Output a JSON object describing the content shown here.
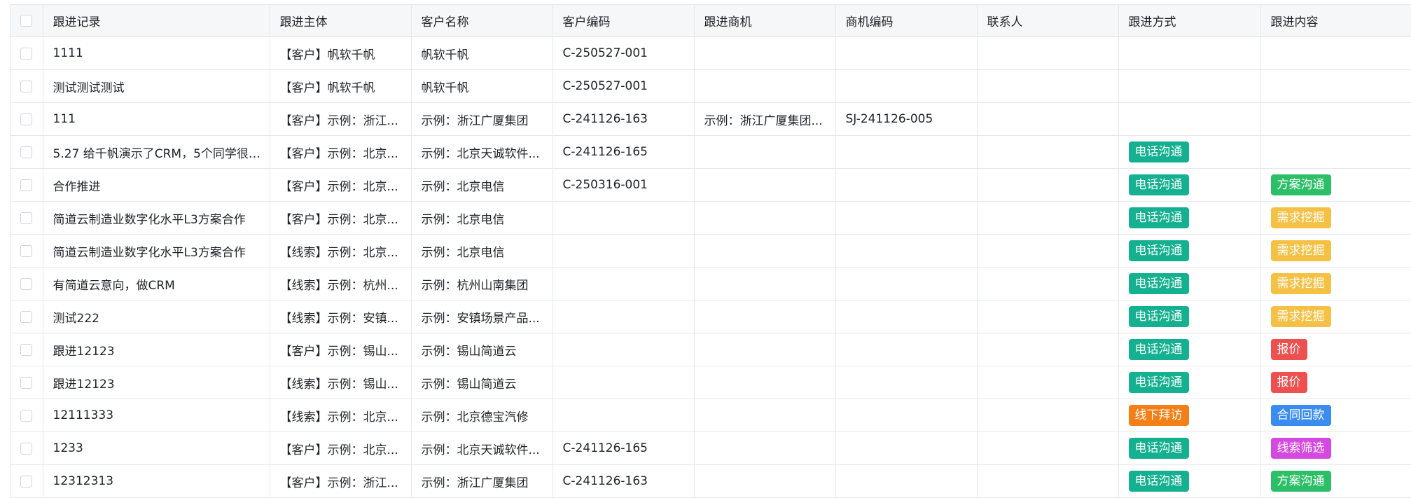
{
  "columns": [
    "跟进记录",
    "跟进主体",
    "客户名称",
    "客户编码",
    "跟进商机",
    "商机编码",
    "联系人",
    "跟进方式",
    "跟进内容"
  ],
  "tag_colors": {
    "电话沟通": "#14b08f",
    "线下拜访": "#f57f17",
    "方案沟通": "#2dbf67",
    "需求挖掘": "#f4c145",
    "报价": "#ee4f4f",
    "合同回款": "#3b8cf0",
    "线索筛选": "#d449e0"
  },
  "rows": [
    {
      "record": "1111",
      "subject": "【客户】帆软千帆",
      "customer": "帆软千帆",
      "code": "C-250527-001",
      "opp": "",
      "opp_code": "",
      "contact": "",
      "method": "",
      "content": ""
    },
    {
      "record": "测试测试测试",
      "subject": "【客户】帆软千帆",
      "customer": "帆软千帆",
      "code": "C-250527-001",
      "opp": "",
      "opp_code": "",
      "contact": "",
      "method": "",
      "content": ""
    },
    {
      "record": "111",
      "subject": "【客户】示例：浙江...",
      "customer": "示例：浙江广厦集团",
      "code": "C-241126-163",
      "opp": "示例：浙江广厦集团...",
      "opp_code": "SJ-241126-005",
      "contact": "",
      "method": "",
      "content": ""
    },
    {
      "record": "5.27 给千帆演示了CRM，5个同学很有...",
      "subject": "【客户】示例：北京...",
      "customer": "示例：北京天诚软件...",
      "code": "C-241126-165",
      "opp": "",
      "opp_code": "",
      "contact": "",
      "method": "电话沟通",
      "content": ""
    },
    {
      "record": "合作推进",
      "subject": "【客户】示例：北京...",
      "customer": "示例：北京电信",
      "code": "C-250316-001",
      "opp": "",
      "opp_code": "",
      "contact": "",
      "method": "电话沟通",
      "content": "方案沟通"
    },
    {
      "record": "简道云制造业数字化水平L3方案合作",
      "subject": "【客户】示例：北京...",
      "customer": "示例：北京电信",
      "code": "",
      "opp": "",
      "opp_code": "",
      "contact": "",
      "method": "电话沟通",
      "content": "需求挖掘"
    },
    {
      "record": "简道云制造业数字化水平L3方案合作",
      "subject": "【线索】示例：北京...",
      "customer": "示例：北京电信",
      "code": "",
      "opp": "",
      "opp_code": "",
      "contact": "",
      "method": "电话沟通",
      "content": "需求挖掘"
    },
    {
      "record": "有简道云意向，做CRM",
      "subject": "【线索】示例：杭州...",
      "customer": "示例：杭州山南集团",
      "code": "",
      "opp": "",
      "opp_code": "",
      "contact": "",
      "method": "电话沟通",
      "content": "需求挖掘"
    },
    {
      "record": "测试222",
      "subject": "【线索】示例：安镇...",
      "customer": "示例：安镇场景产品...",
      "code": "",
      "opp": "",
      "opp_code": "",
      "contact": "",
      "method": "电话沟通",
      "content": "需求挖掘"
    },
    {
      "record": "跟进12123",
      "subject": "【客户】示例：锡山...",
      "customer": "示例：锡山简道云",
      "code": "",
      "opp": "",
      "opp_code": "",
      "contact": "",
      "method": "电话沟通",
      "content": "报价"
    },
    {
      "record": "跟进12123",
      "subject": "【线索】示例：锡山...",
      "customer": "示例：锡山简道云",
      "code": "",
      "opp": "",
      "opp_code": "",
      "contact": "",
      "method": "电话沟通",
      "content": "报价"
    },
    {
      "record": "12111333",
      "subject": "【线索】示例：北京...",
      "customer": "示例：北京德宝汽修",
      "code": "",
      "opp": "",
      "opp_code": "",
      "contact": "",
      "method": "线下拜访",
      "content": "合同回款"
    },
    {
      "record": "1233",
      "subject": "【客户】示例：北京...",
      "customer": "示例：北京天诚软件...",
      "code": "C-241126-165",
      "opp": "",
      "opp_code": "",
      "contact": "",
      "method": "电话沟通",
      "content": "线索筛选"
    },
    {
      "record": "12312313",
      "subject": "【客户】示例：浙江...",
      "customer": "示例：浙江广厦集团",
      "code": "C-241126-163",
      "opp": "",
      "opp_code": "",
      "contact": "",
      "method": "电话沟通",
      "content": "方案沟通"
    }
  ]
}
